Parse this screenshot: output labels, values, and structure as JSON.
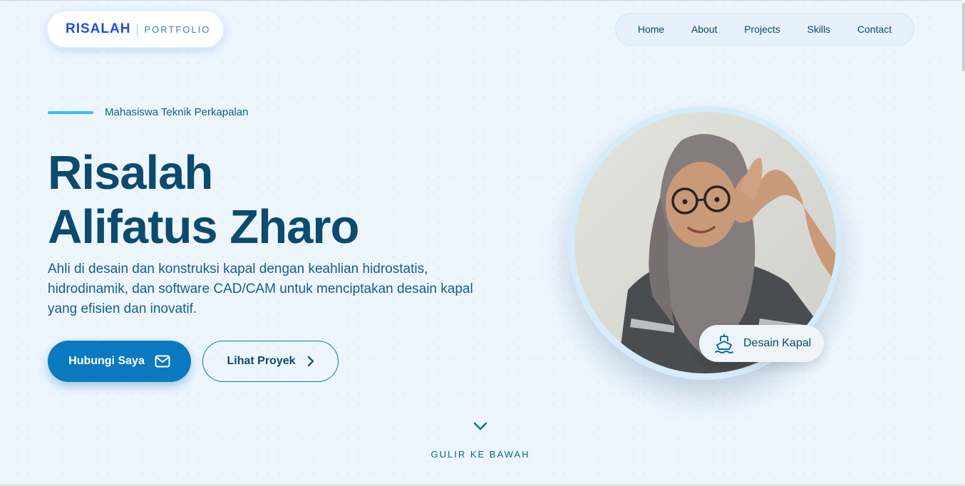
{
  "logo": {
    "name": "RISALAH",
    "subtitle": "PORTFOLIO"
  },
  "nav": {
    "items": [
      "Home",
      "About",
      "Projects",
      "Skills",
      "Contact"
    ]
  },
  "hero": {
    "tagline": "Mahasiswa Teknik Perkapalan",
    "name_line1": "Risalah",
    "name_line2": "Alifatus Zharo",
    "description": "Ahli di desain dan konstruksi kapal dengan keahlian hidrostatis, hidrodinamik, dan software CAD/CAM untuk menciptakan desain kapal yang efisien dan inovatif.",
    "primary_button": "Hubungi Saya",
    "secondary_button": "Lihat Proyek",
    "badge_label": "Desain Kapal",
    "scroll_hint": "GULIR KE BAWAH"
  },
  "icons": {
    "primary_button": "mail-icon",
    "secondary_button": "chevron-right-icon",
    "badge": "ship-icon",
    "scroll_hint": "chevron-down-icon"
  },
  "colors": {
    "background": "#eef6fd",
    "primary": "#0b79bf",
    "heading": "#0c4a6e",
    "accent": "#38bdf8"
  }
}
